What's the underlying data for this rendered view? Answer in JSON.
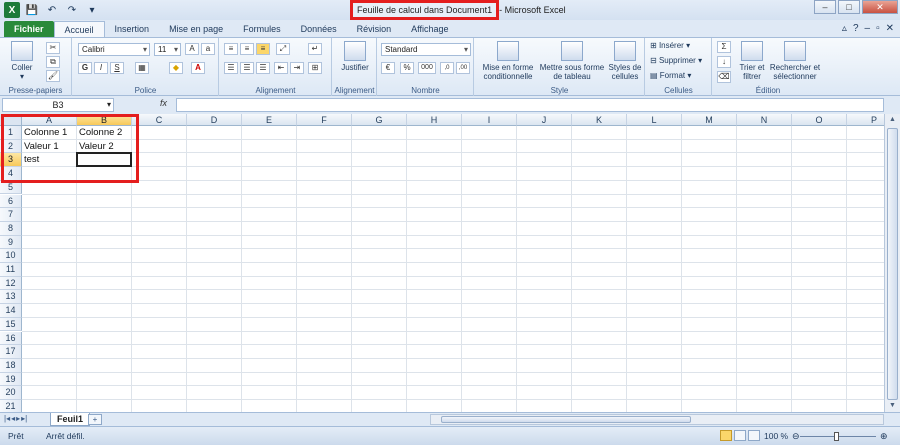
{
  "titlebar": {
    "document": "Feuille de calcul dans Document1",
    "app": " - Microsoft Excel"
  },
  "tabs": [
    "Fichier",
    "Accueil",
    "Insertion",
    "Mise en page",
    "Formules",
    "Données",
    "Révision",
    "Affichage"
  ],
  "ribbon": {
    "clipboard": {
      "paste": "Coller",
      "name": "Presse-papiers"
    },
    "font": {
      "family": "Calibri",
      "size": "11",
      "bold": "G",
      "italic": "I",
      "underline": "S",
      "name": "Police"
    },
    "alignment": {
      "name": "Alignement"
    },
    "justify": {
      "label": "Justifier",
      "name": "Alignement"
    },
    "number": {
      "format": "Standard",
      "percent": "%",
      "thousands": "000",
      "name": "Nombre"
    },
    "style": {
      "conditional": "Mise en forme conditionnelle",
      "table": "Mettre sous forme de tableau",
      "cellstyles": "Styles de cellules",
      "name": "Style"
    },
    "cells": {
      "insert": "Insérer",
      "delete": "Supprimer",
      "format": "Format",
      "name": "Cellules"
    },
    "editing": {
      "sort": "Trier et filtrer",
      "find": "Rechercher et sélectionner",
      "name": "Édition"
    }
  },
  "formulabar": {
    "namebox": "B3",
    "fx": "fx"
  },
  "grid": {
    "columns": [
      "A",
      "B",
      "C",
      "D",
      "E",
      "F",
      "G",
      "H",
      "I",
      "J",
      "K",
      "L",
      "M",
      "N",
      "O",
      "P"
    ],
    "rows": [
      "1",
      "2",
      "3",
      "4",
      "5",
      "6",
      "7",
      "8",
      "9",
      "10",
      "11",
      "12",
      "13",
      "14",
      "15",
      "16",
      "17",
      "18",
      "19",
      "20",
      "21"
    ],
    "cells": {
      "A1": "Colonne 1",
      "B1": "Colonne 2",
      "A2": "Valeur 1",
      "B2": "Valeur 2",
      "A3": "test"
    },
    "selected": "B3"
  },
  "sheets": {
    "active": "Feuil1"
  },
  "status": {
    "ready": "Prêt",
    "scroll": "Arrêt défil.",
    "zoom": "100 %"
  },
  "colors": {
    "accent_red": "#e41e1e",
    "file_tab": "#2a8a3a",
    "selection_header": "#f8c95a"
  }
}
